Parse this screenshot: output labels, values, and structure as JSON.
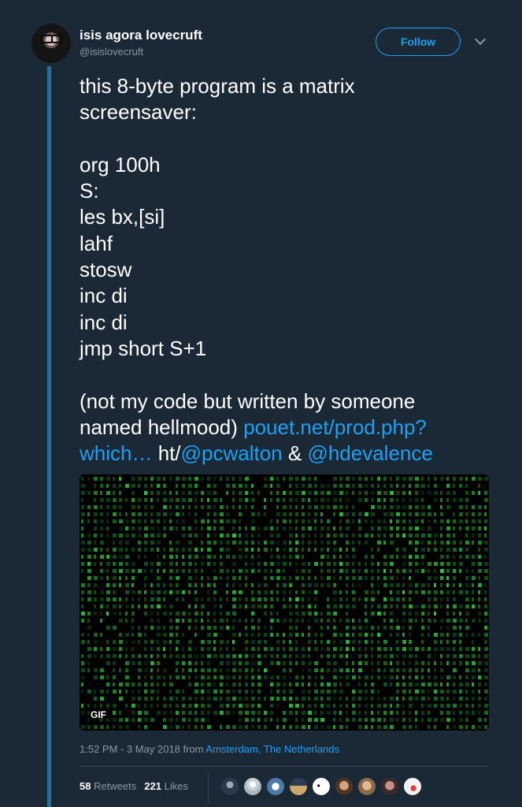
{
  "author": {
    "name": "isis agora lovecruft",
    "handle": "@isislovecruft"
  },
  "header": {
    "follow_label": "Follow",
    "menu_icon": "chevron-down-icon"
  },
  "tweet": {
    "lines": [
      "this 8-byte program is a matrix",
      "screensaver:",
      "",
      "org 100h",
      "S:",
      "les bx,[si]",
      "lahf",
      "stosw",
      "inc di",
      "inc di",
      "jmp short S+1",
      "",
      "(not my code but written by someone"
    ],
    "line14_text": "named hellmood) ",
    "link1_part1": "pouet.net/prod.php?",
    "link1_part2": "which…",
    "ht_text": " ht/",
    "mention1": "@pcwalton",
    "amp_text": " & ",
    "mention2": "@hdevalence"
  },
  "media": {
    "badge": "GIF"
  },
  "meta": {
    "timestamp": "1:52 PM - 3 May 2018 from ",
    "location": "Amsterdam, The Netherlands"
  },
  "stats": {
    "retweets_count": "58",
    "retweets_label": "Retweets",
    "likes_count": "221",
    "likes_label": "Likes"
  },
  "colors": {
    "background": "#1b2836",
    "accent": "#1da1f2",
    "thread": "#2d6d98",
    "muted": "#8899a6"
  }
}
